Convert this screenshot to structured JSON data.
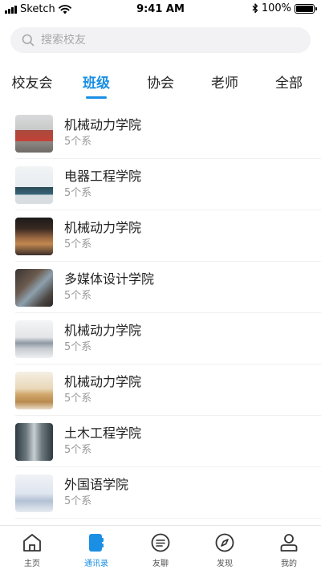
{
  "status_bar": {
    "carrier": "Sketch",
    "time": "9:41 AM",
    "battery": "100%"
  },
  "search": {
    "placeholder": "搜索校友"
  },
  "tabs": [
    {
      "label": "校友会"
    },
    {
      "label": "班级"
    },
    {
      "label": "协会"
    },
    {
      "label": "老师"
    },
    {
      "label": "全部"
    }
  ],
  "active_tab": "班级",
  "list": [
    {
      "title": "机械动力学院",
      "subtitle": "5个系"
    },
    {
      "title": "电器工程学院",
      "subtitle": "5个系"
    },
    {
      "title": "机械动力学院",
      "subtitle": "5个系"
    },
    {
      "title": "多媒体设计学院",
      "subtitle": "5个系"
    },
    {
      "title": "机械动力学院",
      "subtitle": "5个系"
    },
    {
      "title": "机械动力学院",
      "subtitle": "5个系"
    },
    {
      "title": "土木工程学院",
      "subtitle": "5个系"
    },
    {
      "title": "外国语学院",
      "subtitle": "5个系"
    }
  ],
  "tabbar": [
    {
      "label": "主页",
      "icon": "home-icon"
    },
    {
      "label": "通讯录",
      "icon": "contacts-book-icon"
    },
    {
      "label": "友聊",
      "icon": "chat-icon"
    },
    {
      "label": "发现",
      "icon": "compass-icon"
    },
    {
      "label": "我的",
      "icon": "user-icon"
    }
  ],
  "colors": {
    "accent": "#1a8fe3",
    "text": "#222222",
    "subtext": "#999999"
  }
}
